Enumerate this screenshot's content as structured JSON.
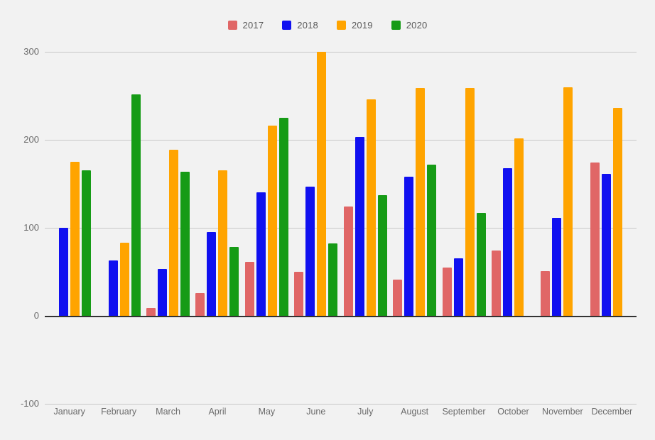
{
  "chart_data": {
    "type": "bar",
    "title": "",
    "subtitle": "",
    "xlabel": "",
    "ylabel": "",
    "grid": true,
    "legend_position": "top-center",
    "ylim": [
      -100,
      300
    ],
    "yticks": [
      300,
      200,
      100,
      0,
      -100
    ],
    "ytick_labels": [
      "300",
      "200",
      "100",
      "0",
      "-100"
    ],
    "categories": [
      "January",
      "February",
      "March",
      "April",
      "May",
      "June",
      "July",
      "August",
      "September",
      "October",
      "November",
      "December"
    ],
    "series": [
      {
        "name": "2017",
        "color": "#e06666",
        "values": [
          0,
          0,
          9,
          26,
          61,
          50,
          124,
          41,
          55,
          74,
          51,
          174
        ]
      },
      {
        "name": "2018",
        "color": "#1010f0",
        "values": [
          100,
          63,
          53,
          95,
          140,
          147,
          203,
          158,
          65,
          168,
          111,
          161
        ]
      },
      {
        "name": "2019",
        "color": "#ffa400",
        "values": [
          175,
          83,
          189,
          165,
          216,
          300,
          246,
          259,
          259,
          202,
          260,
          236
        ]
      },
      {
        "name": "2020",
        "color": "#169b16",
        "values": [
          165,
          252,
          164,
          78,
          225,
          82,
          137,
          172,
          117,
          0,
          0,
          0
        ]
      }
    ]
  },
  "colors": {
    "background": "#f2f2f2",
    "gridline": "#c8c8c8",
    "zero_line": "#333333",
    "tick_text": "#6b6b6b",
    "legend_text": "#5a5a5a"
  }
}
